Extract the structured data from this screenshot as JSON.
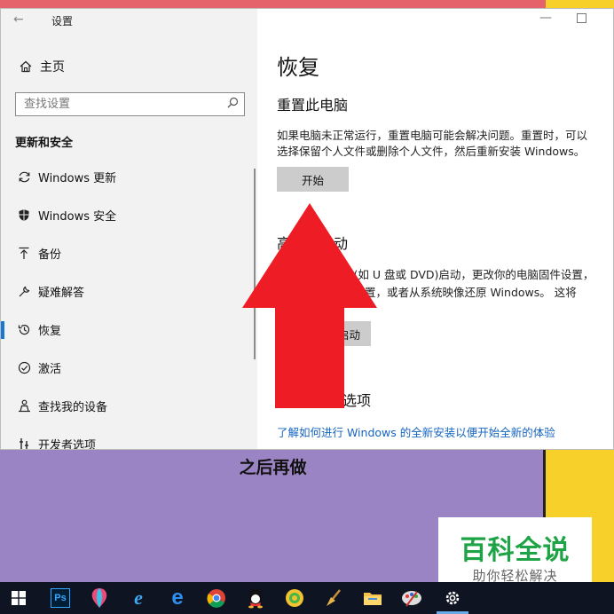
{
  "window": {
    "title": "设置",
    "back_symbol": "←"
  },
  "sidebar": {
    "home_label": "主页",
    "search_placeholder": "查找设置",
    "section_header": "更新和安全",
    "items": [
      {
        "label": "Windows 更新",
        "icon": "sync-icon"
      },
      {
        "label": "Windows 安全",
        "icon": "shield-icon"
      },
      {
        "label": "备份",
        "icon": "upload-icon"
      },
      {
        "label": "疑难解答",
        "icon": "wrench-icon"
      },
      {
        "label": "恢复",
        "icon": "history-icon",
        "active": true
      },
      {
        "label": "激活",
        "icon": "check-circle-icon"
      },
      {
        "label": "查找我的设备",
        "icon": "person-location-icon"
      },
      {
        "label": "开发者选项",
        "icon": "developer-icon"
      }
    ]
  },
  "content": {
    "title": "恢复",
    "reset": {
      "title": "重置此电脑",
      "desc_line1": "如果电脑未正常运行，重置电脑可能会解决问题。重置时，可以",
      "desc_line2": "选择保留个人文件或删除个人文件，然后重新安装 Windows。",
      "button": "开始"
    },
    "advanced": {
      "title_visible": "高",
      "title_tail": "动",
      "desc_line1": "宽(如 U 盘或 DVD)启动，更改你的电脑固件设置，",
      "desc_line2": "动设置，或者从系统映像还原 Windows。 这将",
      "desc_line3": "脑。",
      "button": "启动"
    },
    "more": {
      "title_tail": "选项",
      "link": "了解如何进行 Windows 的全新安装以便开始全新的体验"
    }
  },
  "background": {
    "caption": "之后再做"
  },
  "watermark": {
    "title": "百科全说",
    "subtitle": "助你轻松解决"
  },
  "taskbar": {
    "icons": [
      "windows-start-icon",
      "photoshop-icon",
      "balloon-icon",
      "ie-icon",
      "edge-icon",
      "chrome-icon",
      "qq-icon",
      "browser-360-icon",
      "broom-icon",
      "folder-icon",
      "paint-icon",
      "settings-gear-icon"
    ],
    "ps_label": "Ps"
  },
  "colors": {
    "accent": "#1777d2",
    "arrow": "#ee1c25",
    "link": "#1565c0",
    "watermark_green": "#1ea446"
  }
}
